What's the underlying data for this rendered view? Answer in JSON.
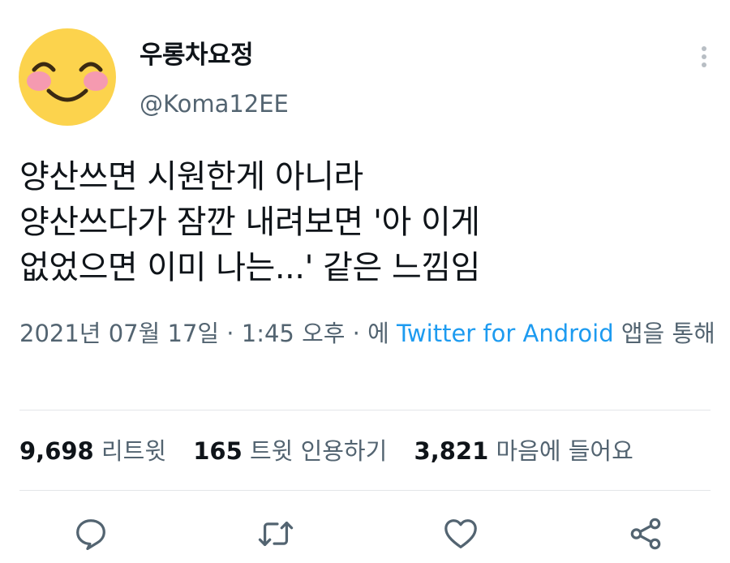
{
  "user": {
    "display_name": "우롱차요정",
    "handle": "@Koma12EE",
    "avatar_icon": "smiling-face-icon"
  },
  "tweet": {
    "text": "양산쓰면 시원한게 아니라\n양산쓰다가 잠깐 내려보면 '아 이게\n없었으면 이미 나는...' 같은 느낌임",
    "date": "2021년 07월 17일",
    "sep1": " · ",
    "time": "1:45 오후",
    "sep2": " · ",
    "via_prefix": "에 ",
    "source": "Twitter for Android",
    "via_suffix": " 앱을 통해"
  },
  "stats": {
    "retweets": "9,698",
    "retweets_label": "리트윗",
    "quotes": "165",
    "quotes_label": "트윗 인용하기",
    "likes": "3,821",
    "likes_label": "마음에 들어요"
  },
  "actions": [
    "reply-icon",
    "retweet-icon",
    "like-icon",
    "share-icon"
  ],
  "colors": {
    "accent": "#1d9bf0",
    "secondary_text": "#536471",
    "icon": "#536471"
  }
}
